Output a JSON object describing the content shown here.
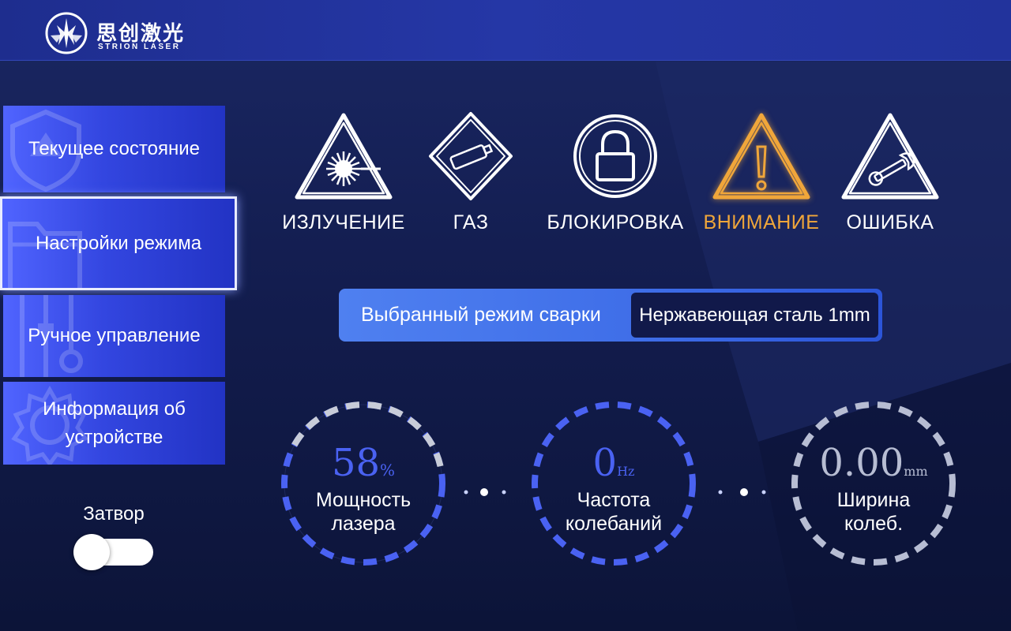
{
  "brand": {
    "name_cn": "思创激光",
    "name_en": "STRION LASER"
  },
  "sidebar": {
    "items": [
      {
        "label": "Текущее состояние",
        "active": false,
        "icon": "shield-icon"
      },
      {
        "label": "Настройки режима",
        "active": true,
        "icon": "folder-icon"
      },
      {
        "label": "Ручное управление",
        "active": false,
        "icon": "sliders-icon"
      },
      {
        "label": "Информация об устройстве",
        "active": false,
        "icon": "gear-icon"
      }
    ],
    "shutter": {
      "label": "Затвор",
      "on": false
    }
  },
  "status": [
    {
      "label": "ИЗЛУЧЕНИЕ",
      "icon": "laser-warning-icon",
      "color": "#ffffff"
    },
    {
      "label": "ГАЗ",
      "icon": "gas-cylinder-icon",
      "color": "#ffffff"
    },
    {
      "label": "БЛОКИРОВКА",
      "icon": "lock-icon",
      "color": "#ffffff"
    },
    {
      "label": "ВНИМАНИЕ",
      "icon": "exclamation-warning-icon",
      "color": "#f0a63a"
    },
    {
      "label": "ОШИБКА",
      "icon": "wrench-warning-icon",
      "color": "#ffffff"
    }
  ],
  "mode": {
    "label": "Выбранный режим сварки",
    "value": "Нержавеющая сталь 1mm"
  },
  "gauges": [
    {
      "value": "58",
      "unit": "%",
      "caption_line1": "Мощность",
      "caption_line2": "лазера",
      "color": "#4a62f2",
      "value_color": "#4a62f2"
    },
    {
      "value": "0",
      "unit": "Hz",
      "caption_line1": "Частота",
      "caption_line2": "колебаний",
      "color": "#4a62f2",
      "value_color": "#4a62f2"
    },
    {
      "value": "0.00",
      "unit": "mm",
      "caption_line1": "Ширина",
      "caption_line2": "колеб.",
      "color": "#b7bdd3",
      "value_color": "#b7bdd3"
    }
  ],
  "colors": {
    "accent": "#3346e0",
    "warning": "#f0a63a",
    "header": "#2537a6"
  }
}
